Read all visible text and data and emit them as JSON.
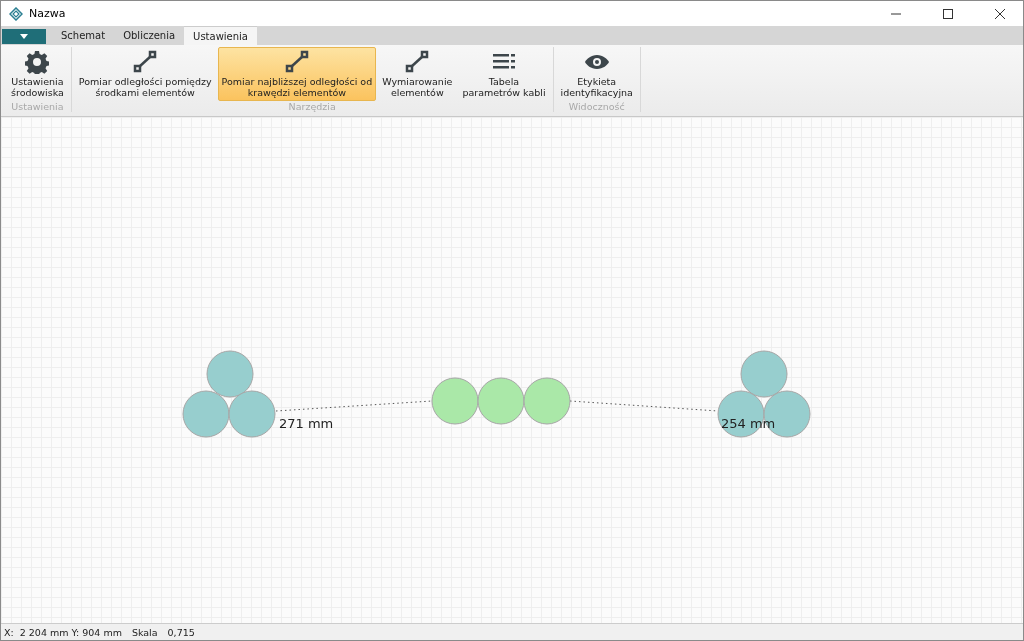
{
  "window": {
    "title": "Nazwa"
  },
  "tabs": [
    {
      "label": "Schemat",
      "selected": false
    },
    {
      "label": "Obliczenia",
      "selected": false
    },
    {
      "label": "Ustawienia",
      "selected": true
    }
  ],
  "ribbon": [
    {
      "label": "Ustawienia",
      "items": [
        {
          "kind": "gear",
          "lines": [
            "Ustawienia",
            "środowiska"
          ],
          "selected": false
        }
      ]
    },
    {
      "label": "Narzędzia",
      "items": [
        {
          "kind": "measure",
          "lines": [
            "Pomiar odległości pomiędzy",
            "środkami elementów"
          ],
          "selected": false
        },
        {
          "kind": "measure",
          "lines": [
            "Pomiar najbliższej odległości od",
            "krawędzi elementów"
          ],
          "selected": true
        },
        {
          "kind": "measure",
          "lines": [
            "Wymiarowanie",
            "elementów"
          ],
          "selected": false
        },
        {
          "kind": "list",
          "lines": [
            "Tabela",
            "parametrów kabli"
          ],
          "selected": false
        }
      ]
    },
    {
      "label": "Widoczność",
      "items": [
        {
          "kind": "eye",
          "lines": [
            "Etykieta",
            "identyfikacyjna"
          ],
          "selected": false
        }
      ]
    }
  ],
  "canvas": {
    "measurements": [
      {
        "label": "271 mm"
      },
      {
        "label": "254 mm"
      }
    ]
  },
  "status_bar": {
    "position": "X:  2 204 mm Y: 904 mm",
    "scale_label": "Skala",
    "scale_value": "0,715"
  }
}
